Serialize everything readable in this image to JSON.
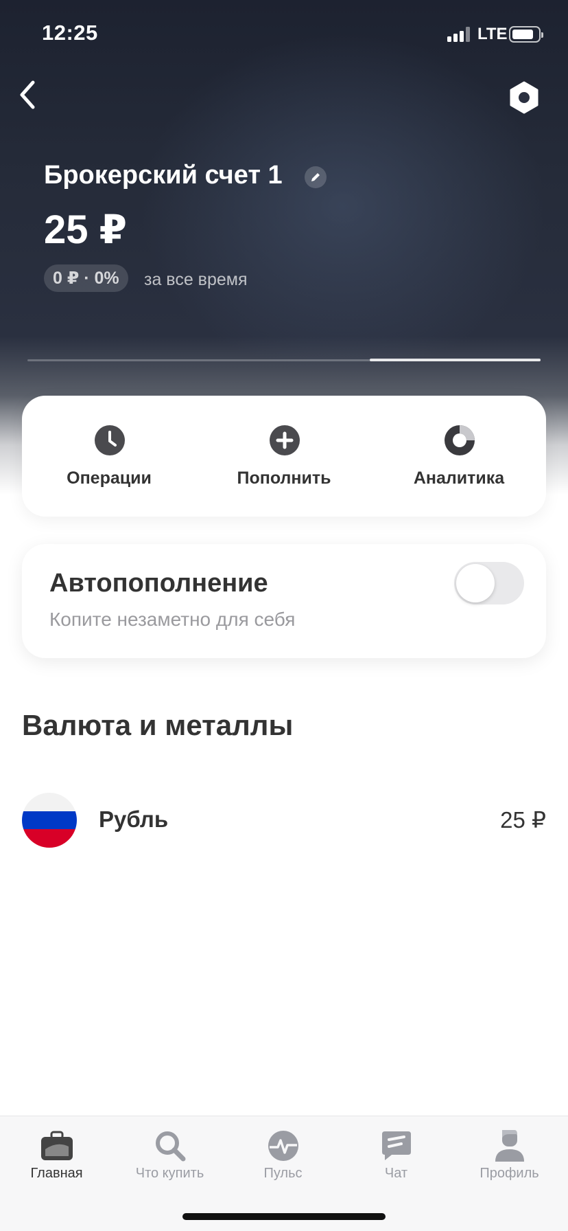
{
  "status_bar": {
    "time": "12:25",
    "network": "LTE"
  },
  "account": {
    "title": "Брокерский счет 1",
    "balance": "25 ₽",
    "gain": "0 ₽ · 0%",
    "gain_period": "за все время"
  },
  "actions": [
    {
      "label": "Операции",
      "icon": "clock-icon"
    },
    {
      "label": "Пополнить",
      "icon": "plus-icon"
    },
    {
      "label": "Аналитика",
      "icon": "pie-chart-icon"
    }
  ],
  "autofill": {
    "title": "Автопополнение",
    "subtitle": "Копите незаметно для себя",
    "enabled": false
  },
  "section": {
    "title": "Валюта и металлы"
  },
  "assets": [
    {
      "name": "Рубль",
      "value": "25 ₽",
      "icon": "russia-flag-icon"
    }
  ],
  "tabs": [
    {
      "label": "Главная",
      "icon": "briefcase-icon",
      "active": true
    },
    {
      "label": "Что купить",
      "icon": "search-icon",
      "active": false
    },
    {
      "label": "Пульс",
      "icon": "pulse-icon",
      "active": false
    },
    {
      "label": "Чат",
      "icon": "chat-icon",
      "active": false
    },
    {
      "label": "Профиль",
      "icon": "profile-icon",
      "active": false
    }
  ],
  "colors": {
    "header_dark": "#252b39",
    "text_primary": "#333333",
    "text_secondary": "#9a9a9e",
    "tab_inactive": "#9a9ca3",
    "flag_white": "#f2f2f2",
    "flag_blue": "#0039c6",
    "flag_red": "#d80027"
  }
}
